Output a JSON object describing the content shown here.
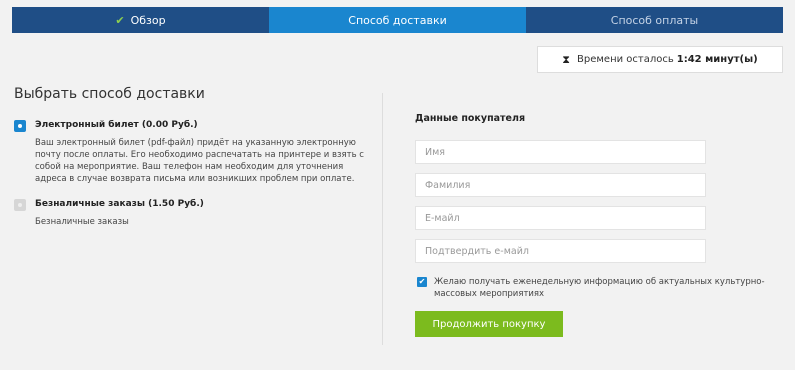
{
  "steps": [
    {
      "label": "Обзор",
      "status": "done",
      "icon": "check-icon"
    },
    {
      "label": "Способ доставки",
      "status": "active"
    },
    {
      "label": "Способ оплаты",
      "status": "upcoming"
    }
  ],
  "timer": {
    "icon": "hourglass-icon",
    "label": "Времени осталось",
    "value": "1:42 минут(ы)"
  },
  "delivery": {
    "title": "Выбрать способ доставки",
    "options": [
      {
        "title": "Электронный билет (0.00 Руб.)",
        "description": "Ваш электронный билет (pdf-файл) придёт на указанную электронную почту после оплаты. Его необходимо распечатать на принтере и взять с собой на мероприятие. Ваш телефон нам необходим для уточнения адреса в случае возврата письма или возникших проблем при оплате.",
        "selected": true
      },
      {
        "title": "Безналичные заказы (1.50 Руб.)",
        "description": "Безналичные заказы",
        "selected": false
      }
    ]
  },
  "buyer": {
    "title": "Данные покупателя",
    "fields": {
      "first_name": {
        "placeholder": "Имя",
        "value": ""
      },
      "last_name": {
        "placeholder": "Фамилия",
        "value": ""
      },
      "email": {
        "placeholder": "E-майл",
        "value": ""
      },
      "confirm_email": {
        "placeholder": "Подтвердить е-майл",
        "value": ""
      }
    },
    "newsletter": {
      "label": "Желаю получать еженедельную информацию об актуальных культурно-массовых мероприятиях",
      "checked": true
    },
    "submit_label": "Продолжить покупку"
  },
  "colors": {
    "nav_dark": "#1f4e86",
    "nav_active": "#1a86cf",
    "accent_green": "#7cbb1e",
    "radio_selected": "#1a86cf"
  }
}
